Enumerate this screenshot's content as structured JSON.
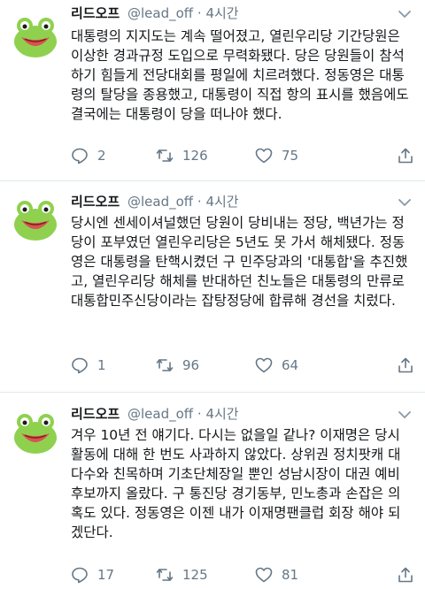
{
  "tweets": [
    {
      "display_name": "리드오프",
      "handle": "@lead_off",
      "separator": "·",
      "time": "4시간",
      "text": "대통령의 지지도는 계속 떨어졌고, 열린우리당 기간당원은 이상한 경과규정 도입으로 무력화됐다. 당은 당원들이 참석하기 힘들게 전당대회를 평일에 치르려했다. 정동영은 대통령의 탈당을 종용했고, 대통령이 직접 항의 표시를 했음에도 결국에는 대통령이 당을 떠나야 했다.",
      "replies": "2",
      "retweets": "126",
      "likes": "75"
    },
    {
      "display_name": "리드오프",
      "handle": "@lead_off",
      "separator": "·",
      "time": "4시간",
      "text": "당시엔 센세이셔널했던 당원이 당비내는 정당, 백년가는 정당이 포부였던 열린우리당은 5년도 못 가서 해체됐다. 정동영은 대통령을 탄핵시켰던 구 민주당과의 '대통합'을 추진했고, 열린우리당 해체를 반대하던 친노들은 대통령의 만류로 대통합민주신당이라는 잡탕정당에 합류해 경선을 치렀다.",
      "replies": "1",
      "retweets": "96",
      "likes": "64"
    },
    {
      "display_name": "리드오프",
      "handle": "@lead_off",
      "separator": "·",
      "time": "4시간",
      "text": "겨우 10년 전 얘기다. 다시는 없을일 같나? 이재명은 당시 활동에 대해 한 번도 사과하지 않았다. 상위권 정치팟캐 대다수와 친목하며 기초단체장일 뿐인 성남시장이 대권 예비후보까지 올랐다. 구 통진당 경기동부, 민노총과 손잡은 의혹도 있다. 정동영은 이젠 내가 이재명팬클럽 회장 해야 되겠단다.",
      "replies": "17",
      "retweets": "125",
      "likes": "81"
    }
  ],
  "icons": {
    "avatar": "green-frog-avatar-icon",
    "caret": "chevron-down-icon",
    "reply": "reply-icon",
    "retweet": "retweet-icon",
    "like": "heart-icon",
    "share": "share-icon"
  },
  "colors": {
    "text": "#14171a",
    "secondary": "#657786",
    "divider": "#e1e8ed",
    "avatar_green": "#8fd14f",
    "avatar_mouth": "#d9534f"
  }
}
